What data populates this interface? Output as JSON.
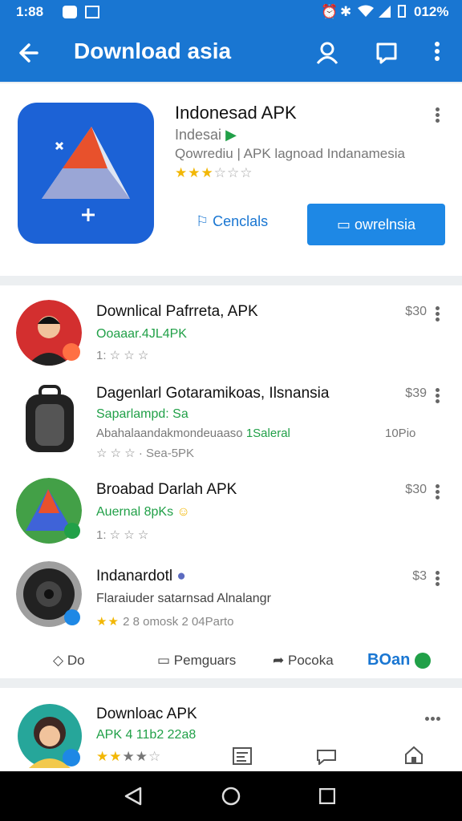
{
  "status_bar": {
    "time": "1:88",
    "battery": "012%"
  },
  "app_bar": {
    "title": "Download asia"
  },
  "featured": {
    "name": "Indonesad APK",
    "developer": "Indesai",
    "description": "Qowrediu | APK lagnoad Indanamesia",
    "rating_stars": 2.5,
    "secondary_button": "Cenclals",
    "primary_button": "owrelnsia"
  },
  "list": [
    {
      "name": "Downlical Pafrreta, APK",
      "sub": "Ooaaar.4JL4PK",
      "meta": "1: ☆ ☆ ☆",
      "price": "$30"
    },
    {
      "name": "Dagenlarl Gotaramikoas, Ilsnansia",
      "sub": "Saparlampd: Sa",
      "desc": "Abahalaandakmondeuaaso",
      "desc_green": "1Saleral",
      "desc_size": "10Pio",
      "meta": "☆ ☆ ☆ · Sea-5PK",
      "price": "$39"
    },
    {
      "name": "Broabad Darlah APK",
      "sub": "Auernal 8pKs",
      "meta": "1: ☆ ☆ ☆",
      "price": "$30"
    },
    {
      "name": "Indanardotl",
      "sub": "Flaraiuder satarnsad Alnalangr",
      "meta": "2 8 omosk 2 04Parto",
      "price": "$3"
    }
  ],
  "actions": {
    "do": "Do",
    "pengurals": "Pemguars",
    "pocoka": "Pocoka",
    "boan": "BOan"
  },
  "bottom_item": {
    "name": "Downloac APK",
    "sub": "APK 4 11b2 22a8"
  }
}
